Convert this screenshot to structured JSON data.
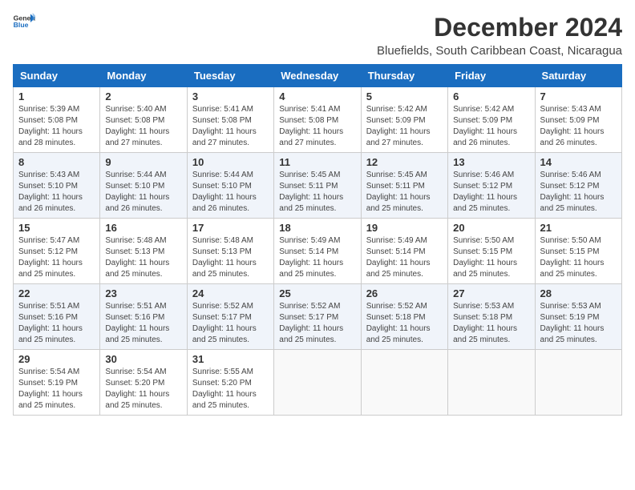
{
  "logo": {
    "text_general": "General",
    "text_blue": "Blue"
  },
  "title": "December 2024",
  "subtitle": "Bluefields, South Caribbean Coast, Nicaragua",
  "weekdays": [
    "Sunday",
    "Monday",
    "Tuesday",
    "Wednesday",
    "Thursday",
    "Friday",
    "Saturday"
  ],
  "weeks": [
    [
      {
        "day": "1",
        "info": "Sunrise: 5:39 AM\nSunset: 5:08 PM\nDaylight: 11 hours\nand 28 minutes."
      },
      {
        "day": "2",
        "info": "Sunrise: 5:40 AM\nSunset: 5:08 PM\nDaylight: 11 hours\nand 27 minutes."
      },
      {
        "day": "3",
        "info": "Sunrise: 5:41 AM\nSunset: 5:08 PM\nDaylight: 11 hours\nand 27 minutes."
      },
      {
        "day": "4",
        "info": "Sunrise: 5:41 AM\nSunset: 5:08 PM\nDaylight: 11 hours\nand 27 minutes."
      },
      {
        "day": "5",
        "info": "Sunrise: 5:42 AM\nSunset: 5:09 PM\nDaylight: 11 hours\nand 27 minutes."
      },
      {
        "day": "6",
        "info": "Sunrise: 5:42 AM\nSunset: 5:09 PM\nDaylight: 11 hours\nand 26 minutes."
      },
      {
        "day": "7",
        "info": "Sunrise: 5:43 AM\nSunset: 5:09 PM\nDaylight: 11 hours\nand 26 minutes."
      }
    ],
    [
      {
        "day": "8",
        "info": "Sunrise: 5:43 AM\nSunset: 5:10 PM\nDaylight: 11 hours\nand 26 minutes."
      },
      {
        "day": "9",
        "info": "Sunrise: 5:44 AM\nSunset: 5:10 PM\nDaylight: 11 hours\nand 26 minutes."
      },
      {
        "day": "10",
        "info": "Sunrise: 5:44 AM\nSunset: 5:10 PM\nDaylight: 11 hours\nand 26 minutes."
      },
      {
        "day": "11",
        "info": "Sunrise: 5:45 AM\nSunset: 5:11 PM\nDaylight: 11 hours\nand 25 minutes."
      },
      {
        "day": "12",
        "info": "Sunrise: 5:45 AM\nSunset: 5:11 PM\nDaylight: 11 hours\nand 25 minutes."
      },
      {
        "day": "13",
        "info": "Sunrise: 5:46 AM\nSunset: 5:12 PM\nDaylight: 11 hours\nand 25 minutes."
      },
      {
        "day": "14",
        "info": "Sunrise: 5:46 AM\nSunset: 5:12 PM\nDaylight: 11 hours\nand 25 minutes."
      }
    ],
    [
      {
        "day": "15",
        "info": "Sunrise: 5:47 AM\nSunset: 5:12 PM\nDaylight: 11 hours\nand 25 minutes."
      },
      {
        "day": "16",
        "info": "Sunrise: 5:48 AM\nSunset: 5:13 PM\nDaylight: 11 hours\nand 25 minutes."
      },
      {
        "day": "17",
        "info": "Sunrise: 5:48 AM\nSunset: 5:13 PM\nDaylight: 11 hours\nand 25 minutes."
      },
      {
        "day": "18",
        "info": "Sunrise: 5:49 AM\nSunset: 5:14 PM\nDaylight: 11 hours\nand 25 minutes."
      },
      {
        "day": "19",
        "info": "Sunrise: 5:49 AM\nSunset: 5:14 PM\nDaylight: 11 hours\nand 25 minutes."
      },
      {
        "day": "20",
        "info": "Sunrise: 5:50 AM\nSunset: 5:15 PM\nDaylight: 11 hours\nand 25 minutes."
      },
      {
        "day": "21",
        "info": "Sunrise: 5:50 AM\nSunset: 5:15 PM\nDaylight: 11 hours\nand 25 minutes."
      }
    ],
    [
      {
        "day": "22",
        "info": "Sunrise: 5:51 AM\nSunset: 5:16 PM\nDaylight: 11 hours\nand 25 minutes."
      },
      {
        "day": "23",
        "info": "Sunrise: 5:51 AM\nSunset: 5:16 PM\nDaylight: 11 hours\nand 25 minutes."
      },
      {
        "day": "24",
        "info": "Sunrise: 5:52 AM\nSunset: 5:17 PM\nDaylight: 11 hours\nand 25 minutes."
      },
      {
        "day": "25",
        "info": "Sunrise: 5:52 AM\nSunset: 5:17 PM\nDaylight: 11 hours\nand 25 minutes."
      },
      {
        "day": "26",
        "info": "Sunrise: 5:52 AM\nSunset: 5:18 PM\nDaylight: 11 hours\nand 25 minutes."
      },
      {
        "day": "27",
        "info": "Sunrise: 5:53 AM\nSunset: 5:18 PM\nDaylight: 11 hours\nand 25 minutes."
      },
      {
        "day": "28",
        "info": "Sunrise: 5:53 AM\nSunset: 5:19 PM\nDaylight: 11 hours\nand 25 minutes."
      }
    ],
    [
      {
        "day": "29",
        "info": "Sunrise: 5:54 AM\nSunset: 5:19 PM\nDaylight: 11 hours\nand 25 minutes."
      },
      {
        "day": "30",
        "info": "Sunrise: 5:54 AM\nSunset: 5:20 PM\nDaylight: 11 hours\nand 25 minutes."
      },
      {
        "day": "31",
        "info": "Sunrise: 5:55 AM\nSunset: 5:20 PM\nDaylight: 11 hours\nand 25 minutes."
      },
      null,
      null,
      null,
      null
    ]
  ]
}
